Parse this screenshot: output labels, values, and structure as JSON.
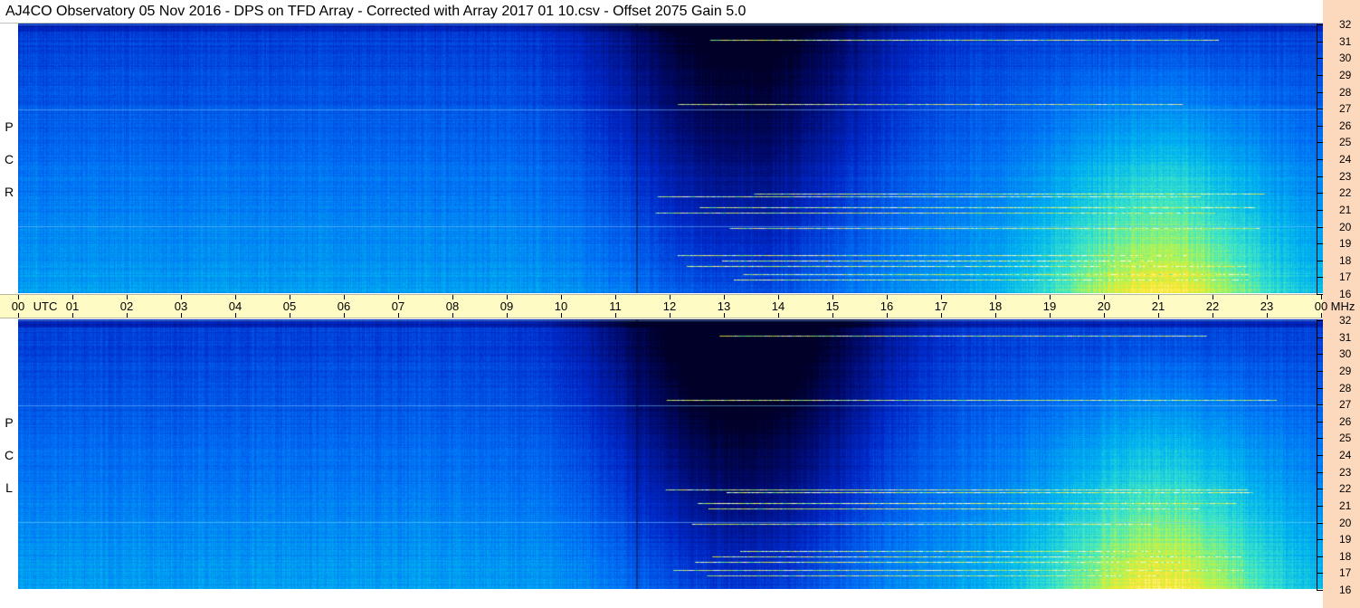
{
  "title": "AJ4CO Observatory  05 Nov 2016  -  DPS on TFD Array  -  Corrected with Array 2017 01 10.csv  -  Offset 2075  Gain 5.0",
  "chart_data": {
    "type": "heatmap",
    "panels": [
      {
        "name": "R C P",
        "letters": [
          "R",
          "C",
          "P"
        ]
      },
      {
        "name": "L C P",
        "letters": [
          "L",
          "C",
          "P"
        ]
      }
    ],
    "time_axis": {
      "labels": [
        "00",
        "UTC",
        "01",
        "02",
        "03",
        "04",
        "05",
        "06",
        "07",
        "08",
        "09",
        "10",
        "11",
        "12",
        "13",
        "14",
        "15",
        "16",
        "17",
        "18",
        "19",
        "20",
        "21",
        "22",
        "23",
        "00",
        "MHz"
      ],
      "hours": [
        0,
        1,
        2,
        3,
        4,
        5,
        6,
        7,
        8,
        9,
        10,
        11,
        12,
        13,
        14,
        15,
        16,
        17,
        18,
        19,
        20,
        21,
        22,
        23,
        24
      ],
      "range": [
        0,
        24
      ]
    },
    "freq_axis": {
      "unit": "MHz",
      "ticks": [
        "16",
        "17",
        "18",
        "19",
        "20",
        "21",
        "22",
        "23",
        "24",
        "25",
        "26",
        "27",
        "28",
        "29",
        "30",
        "31",
        "32"
      ],
      "range": [
        16,
        32
      ]
    }
  }
}
